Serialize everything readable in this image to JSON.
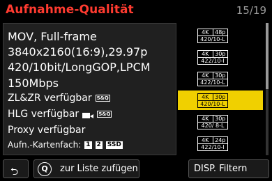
{
  "header": {
    "title": "Aufnahme-Qualität",
    "pager": "15/19"
  },
  "details": {
    "format": "MOV, Full-frame",
    "resolution": "3840x2160(16:9),29.97p",
    "codec": "420/10bit/LongGOP,LPCM",
    "bitrate": "150Mbps",
    "zl_zr": "ZL&ZR verfügbar",
    "zl_zr_badge": "S&Q",
    "hlg": "HLG verfügbar",
    "hlg_badge": "S&Q",
    "proxy": "Proxy verfügbar",
    "card_slot_label": "Aufn.-Kartenfach:",
    "slots": [
      "1",
      "2",
      "SSD"
    ]
  },
  "quality_list": [
    {
      "res": "4K",
      "fps": "48p",
      "spec": "420/10-L",
      "selected": false
    },
    {
      "res": "4K",
      "fps": "30p",
      "spec": "422/10-I",
      "selected": false
    },
    {
      "res": "4K",
      "fps": "30p",
      "spec": "422/10-L",
      "selected": false
    },
    {
      "res": "4K",
      "fps": "30p",
      "spec": "420/10-L",
      "selected": true
    },
    {
      "res": "4K",
      "fps": "30p",
      "spec": "420/ 8-L",
      "selected": false
    },
    {
      "res": "4K",
      "fps": "24p",
      "spec": "422/10-I",
      "selected": false
    }
  ],
  "footer": {
    "back_icon": "return-arrow-icon",
    "add_button_key": "Q",
    "add_button_label": "zur Liste zufügen",
    "filter_button_label": "DISP. Filtern"
  },
  "colors": {
    "title": "#ff3b30",
    "selection": "#f0d000"
  }
}
